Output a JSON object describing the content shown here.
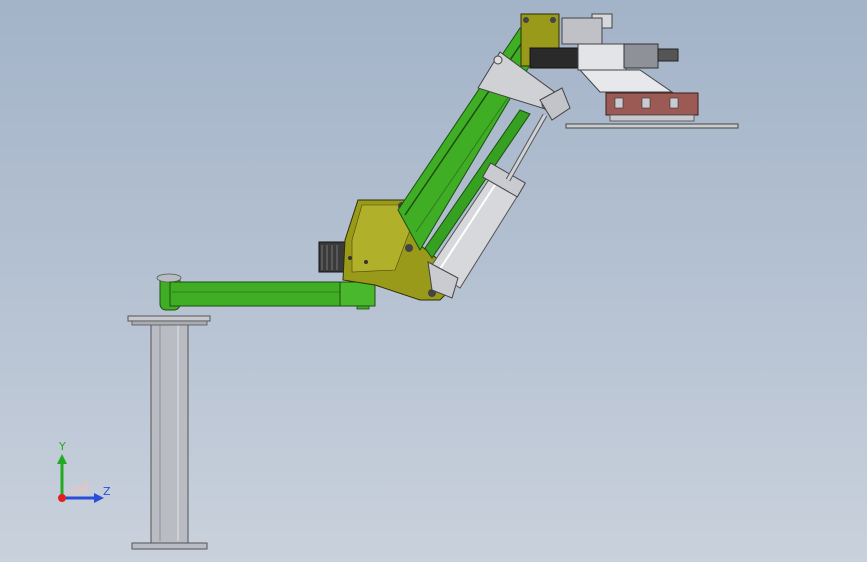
{
  "app": {
    "type": "cad-viewport"
  },
  "colors": {
    "background_top": "#a3b3c8",
    "background_bottom": "#c9d1dc",
    "arm_green": "#3fae25",
    "bracket_olive": "#9a9a1a",
    "pedestal_grey": "#b9bcc2",
    "cylinder_silver": "#d6d8dc",
    "gripper_red": "#9c5a54",
    "axis_x": "#e02020",
    "axis_y": "#22aa22",
    "axis_z": "#2a4fd6"
  },
  "triad": {
    "y_label": "Y",
    "z_label": "Z"
  }
}
